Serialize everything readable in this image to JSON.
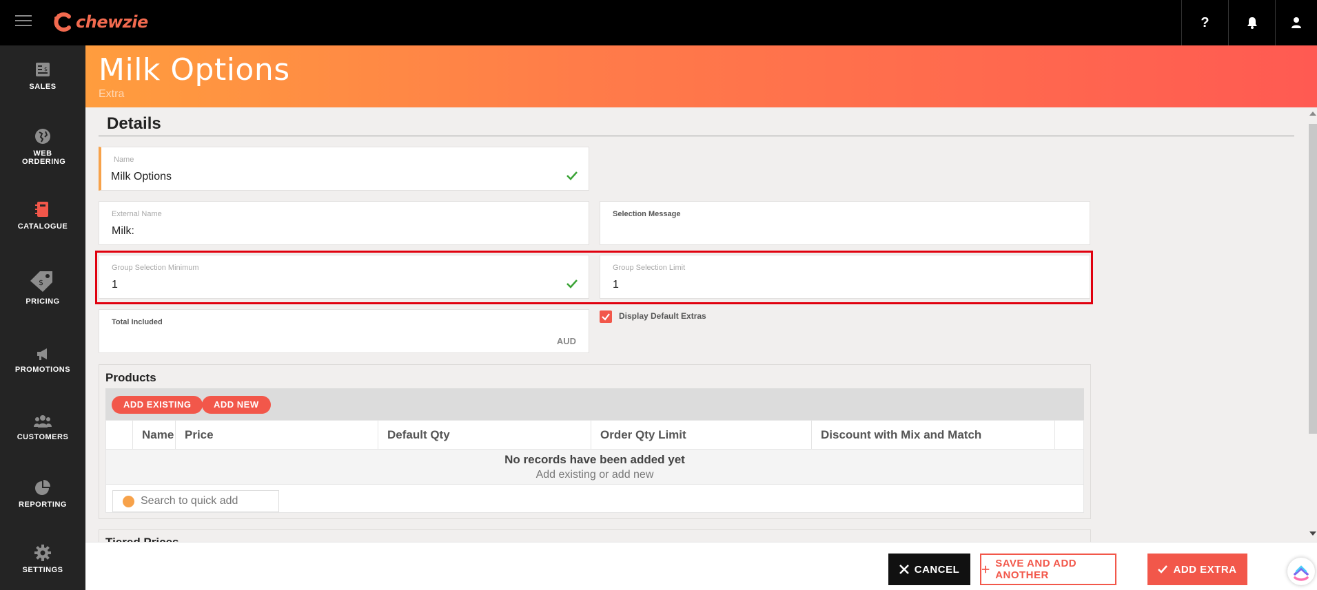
{
  "app": {
    "brand": "chewzie"
  },
  "topbar": {
    "help_label": "?",
    "icons": [
      "hamburger-icon",
      "question-icon",
      "bell-icon",
      "user-icon"
    ]
  },
  "sidebar": {
    "items": [
      {
        "label": "SALES",
        "icon": "sales-icon"
      },
      {
        "label": "WEB ORDERING",
        "icon": "globe-icon"
      },
      {
        "label": "CATALOGUE",
        "icon": "book-icon"
      },
      {
        "label": "PRICING",
        "icon": "tag-icon"
      },
      {
        "label": "PROMOTIONS",
        "icon": "megaphone-icon"
      },
      {
        "label": "CUSTOMERS",
        "icon": "users-icon"
      },
      {
        "label": "REPORTING",
        "icon": "pie-chart-icon"
      },
      {
        "label": "SETTINGS",
        "icon": "gear-icon"
      }
    ],
    "active_color": "#f2574a"
  },
  "header": {
    "title": "Milk Options",
    "subtitle": "Extra"
  },
  "details": {
    "title": "Details",
    "name": {
      "label": "Name",
      "value": "Milk Options"
    },
    "external_name": {
      "label": "External Name",
      "value": "Milk:"
    },
    "selection_message": {
      "label": "Selection Message",
      "value": ""
    },
    "group_min": {
      "label": "Group Selection Minimum",
      "value": "1"
    },
    "group_limit": {
      "label": "Group Selection Limit",
      "value": "1"
    },
    "total_included": {
      "label": "Total Included",
      "value": "",
      "suffix": "AUD"
    },
    "display_default_extras": {
      "label": "Display Default Extras",
      "checked": true
    }
  },
  "products": {
    "title": "Products",
    "add_existing": "ADD EXISTING",
    "add_new": "ADD NEW",
    "columns": [
      "Name",
      "Price",
      "Default Qty",
      "Order Qty Limit",
      "Discount with Mix and Match"
    ],
    "empty_title": "No records have been added yet",
    "empty_sub": "Add existing or add new",
    "search_placeholder": "Search to quick add"
  },
  "tiered": {
    "title": "Tiered Prices"
  },
  "footer": {
    "cancel": "CANCEL",
    "save_another": "SAVE AND ADD ANOTHER",
    "add_extra": "ADD EXTRA"
  },
  "colors": {
    "accent": "#f2574a",
    "banner_start": "#ff9d3e",
    "banner_end": "#ff5a52",
    "highlight": "#e0000e"
  }
}
